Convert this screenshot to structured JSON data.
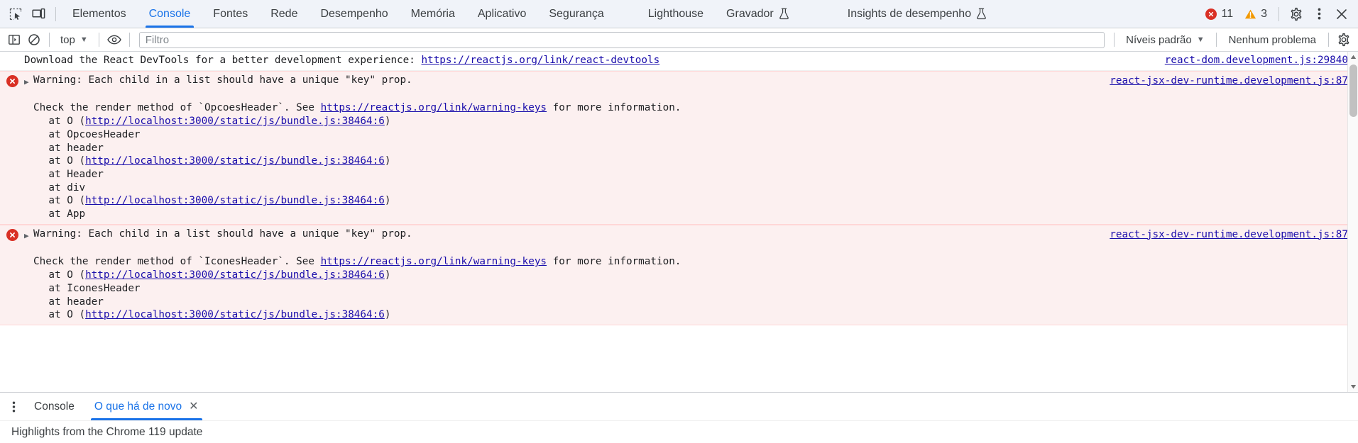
{
  "tabbar": {
    "inspect_icon": "inspect-element-icon",
    "device_icon": "device-toolbar-icon",
    "tabs": [
      {
        "label": "Elementos",
        "active": false,
        "flask": false
      },
      {
        "label": "Console",
        "active": true,
        "flask": false
      },
      {
        "label": "Fontes",
        "active": false,
        "flask": false
      },
      {
        "label": "Rede",
        "active": false,
        "flask": false
      },
      {
        "label": "Desempenho",
        "active": false,
        "flask": false
      },
      {
        "label": "Memória",
        "active": false,
        "flask": false
      },
      {
        "label": "Aplicativo",
        "active": false,
        "flask": false
      },
      {
        "label": "Segurança",
        "active": false,
        "flask": false
      },
      {
        "label": "Lighthouse",
        "active": false,
        "flask": false
      },
      {
        "label": "Gravador",
        "active": false,
        "flask": true
      },
      {
        "label": "Insights de desempenho",
        "active": false,
        "flask": true
      }
    ],
    "error_count": "11",
    "warning_count": "3",
    "settings_icon": "gear-icon",
    "more_icon": "kebab-menu-icon",
    "close_icon": "close-icon",
    "error_color": "#d93025",
    "warning_color": "#f29900",
    "accent_color": "#1a73e8"
  },
  "console_toolbar": {
    "sidebar_icon": "console-sidebar-icon",
    "clear_icon": "clear-console-icon",
    "context": "top",
    "eye_icon": "live-expression-icon",
    "filter_placeholder": "Filtro",
    "filter_value": "",
    "levels": "Níveis padrão",
    "issues": "Nenhum problema",
    "settings_icon": "console-settings-gear-icon"
  },
  "console": {
    "messages": [
      {
        "type": "info",
        "text_before": "Download the React DevTools for a better development experience: ",
        "link": "https://reactjs.org/link/react-devtools",
        "source": "react-dom.development.js:29840"
      },
      {
        "type": "error",
        "triangle": "▶",
        "headline": "Warning: Each child in a list should have a unique \"key\" prop.",
        "source": "react-jsx-dev-runtime.development.js:87",
        "detail_before": "Check the render method of `OpcoesHeader`. See ",
        "detail_link": "https://reactjs.org/link/warning-keys",
        "detail_after": " for more information.",
        "stack": [
          {
            "prefix": "    at O (",
            "link": "http://localhost:3000/static/js/bundle.js:38464:6",
            "suffix": ")"
          },
          {
            "prefix": "    at OpcoesHeader",
            "link": "",
            "suffix": ""
          },
          {
            "prefix": "    at header",
            "link": "",
            "suffix": ""
          },
          {
            "prefix": "    at O (",
            "link": "http://localhost:3000/static/js/bundle.js:38464:6",
            "suffix": ")"
          },
          {
            "prefix": "    at Header",
            "link": "",
            "suffix": ""
          },
          {
            "prefix": "    at div",
            "link": "",
            "suffix": ""
          },
          {
            "prefix": "    at O (",
            "link": "http://localhost:3000/static/js/bundle.js:38464:6",
            "suffix": ")"
          },
          {
            "prefix": "    at App",
            "link": "",
            "suffix": ""
          }
        ]
      },
      {
        "type": "error",
        "triangle": "▶",
        "headline": "Warning: Each child in a list should have a unique \"key\" prop.",
        "source": "react-jsx-dev-runtime.development.js:87",
        "detail_before": "Check the render method of `IconesHeader`. See ",
        "detail_link": "https://reactjs.org/link/warning-keys",
        "detail_after": " for more information.",
        "stack": [
          {
            "prefix": "    at O (",
            "link": "http://localhost:3000/static/js/bundle.js:38464:6",
            "suffix": ")"
          },
          {
            "prefix": "    at IconesHeader",
            "link": "",
            "suffix": ""
          },
          {
            "prefix": "    at header",
            "link": "",
            "suffix": ""
          },
          {
            "prefix": "    at O (",
            "link": "http://localhost:3000/static/js/bundle.js:38464:6",
            "suffix": ")"
          }
        ]
      }
    ]
  },
  "drawer": {
    "menu_icon": "drawer-menu-icon",
    "tabs": [
      {
        "label": "Console",
        "active": false,
        "closable": false
      },
      {
        "label": "O que há de novo",
        "active": true,
        "closable": true
      }
    ],
    "close_icon": "close-tab-icon"
  },
  "status": {
    "text": "Highlights from the Chrome 119 update"
  }
}
